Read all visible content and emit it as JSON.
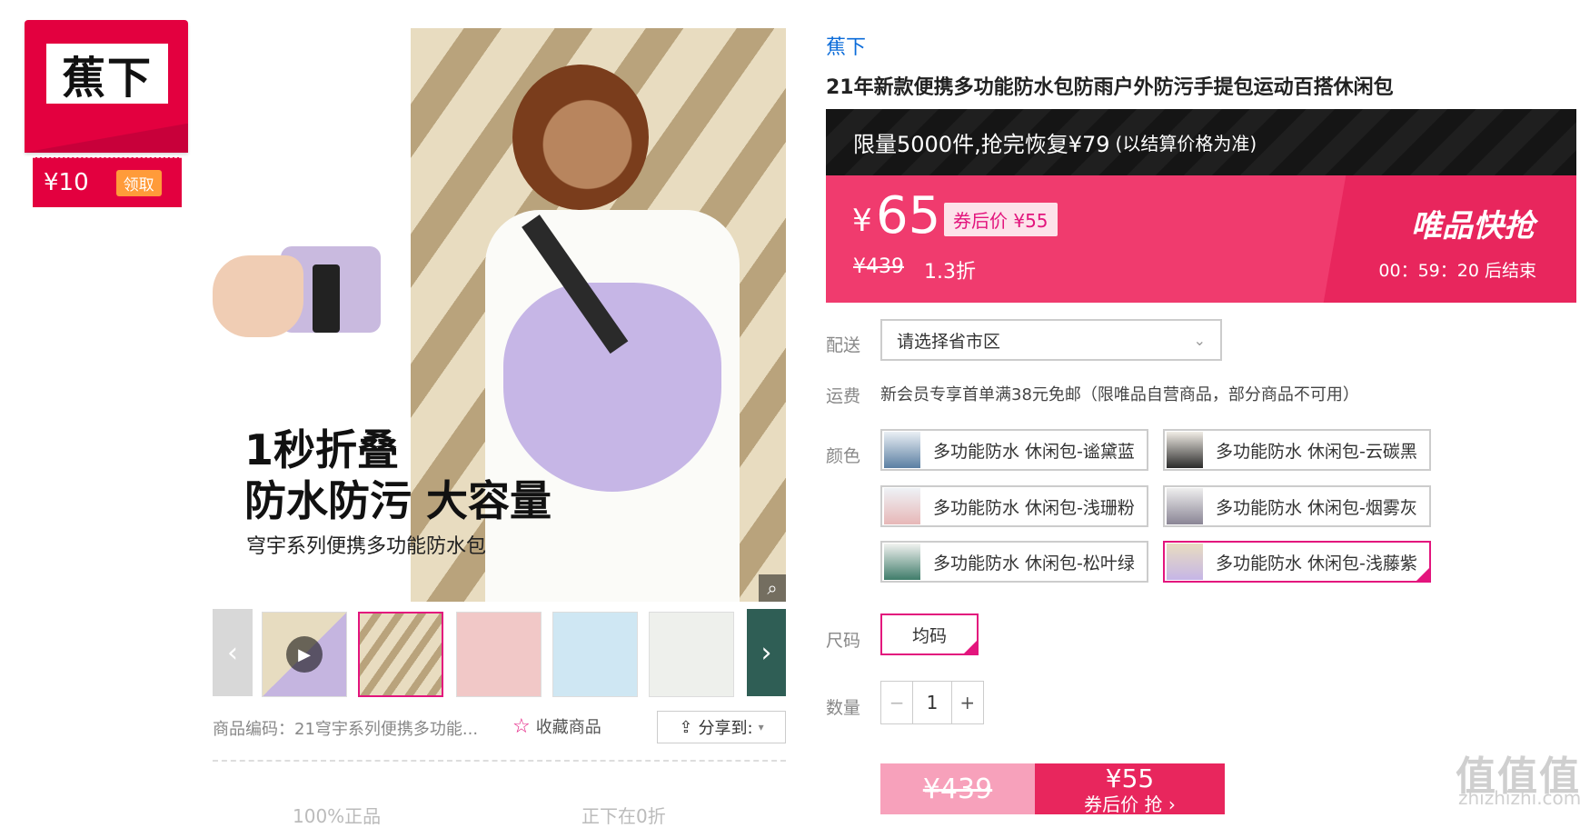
{
  "brand_badge": {
    "logo_text": "蕉下",
    "coupon_amount": "¥10",
    "coupon_button": "领取"
  },
  "main_image": {
    "headline_line1": "1秒折叠",
    "headline_line2": "防水防污 大容量",
    "headline_line3": "穹宇系列便携多功能防水包"
  },
  "thumbnails": {
    "prev": "‹",
    "next": "›",
    "play_icon": "play-icon"
  },
  "meta": {
    "product_code": "商品编码：21穹宇系列便携多功能...",
    "favorite": "收藏商品",
    "share": "分享到:",
    "bottom_hint1": "100%正品",
    "bottom_hint2": "正下在0折"
  },
  "product": {
    "brand": "蕉下",
    "title": "21年新款便携多功能防水包防雨户外防污手提包运动百搭休闲包"
  },
  "promo": {
    "main": "限量5000件,抢完恢复¥79",
    "note": "(以结算价格为准)"
  },
  "price": {
    "currency": "¥",
    "value": "65",
    "coupon_price": "券后价 ¥55",
    "original": "¥439",
    "discount": "1.3折",
    "flash_label": "唯品快抢",
    "countdown": "00：59：20  后结束"
  },
  "delivery": {
    "label": "配送",
    "placeholder": "请选择省市区"
  },
  "freight": {
    "label": "运费",
    "text": "新会员专享首单满38元免邮（限唯品自营商品，部分商品不可用）"
  },
  "colors": {
    "label": "颜色",
    "options": [
      "多功能防水 休闲包-谧黛蓝",
      "多功能防水 休闲包-云碳黑",
      "多功能防水 休闲包-浅珊粉",
      "多功能防水 休闲包-烟雾灰",
      "多功能防水 休闲包-松叶绿",
      "多功能防水 休闲包-浅藤紫"
    ],
    "selected_index": 5
  },
  "size": {
    "label": "尺码",
    "option": "均码"
  },
  "quantity": {
    "label": "数量",
    "minus": "−",
    "value": "1",
    "plus": "+"
  },
  "buy": {
    "left_price": "¥439",
    "right_price": "¥55",
    "right_label": "券后价 抢 ›"
  },
  "watermark": {
    "main": "值值值",
    "sub": "zhizhizhi.com"
  },
  "colors_theme": {
    "accent": "#e3157d",
    "price_bg": "#f03b6e",
    "brand_red": "#e3003f"
  }
}
